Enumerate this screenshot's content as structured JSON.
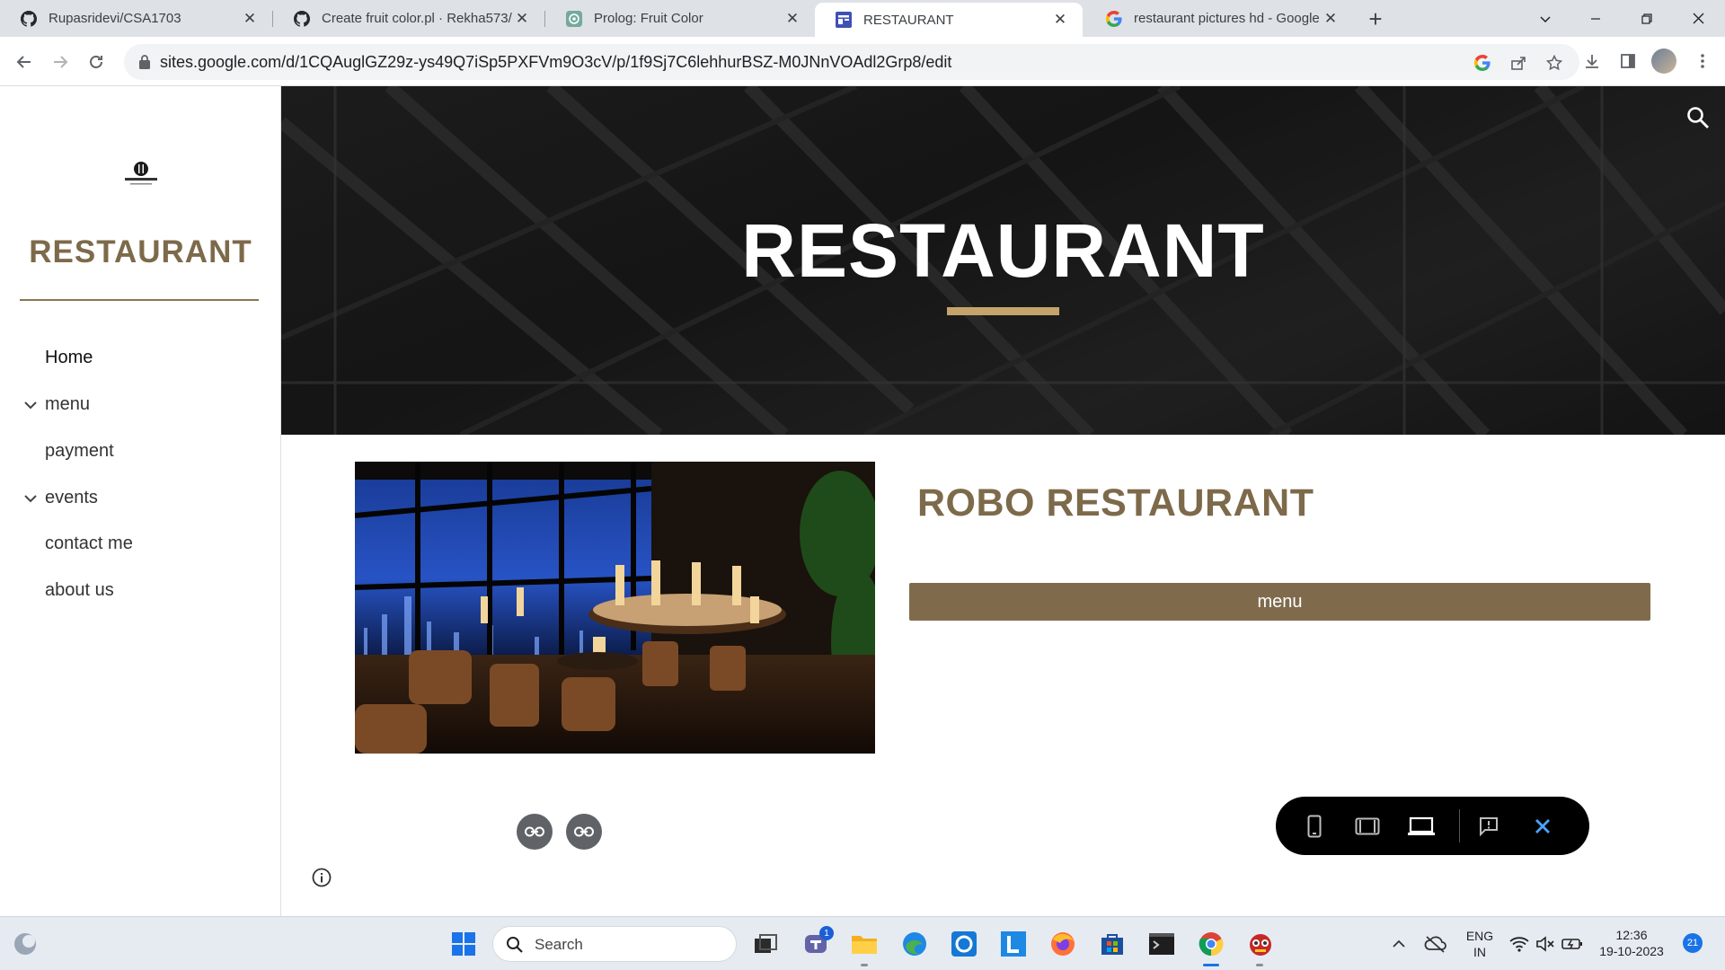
{
  "browser": {
    "tabs": [
      {
        "title": "Rupasridevi/CSA1703",
        "icon": "github-icon"
      },
      {
        "title": "Create fruit color.pl · Rekha573/(",
        "icon": "github-icon"
      },
      {
        "title": "Prolog: Fruit Color",
        "icon": "chatgpt-icon"
      },
      {
        "title": "RESTAURANT",
        "icon": "google-sites-icon",
        "active": true
      },
      {
        "title": "restaurant pictures hd - Google S",
        "icon": "google-icon"
      }
    ],
    "url": "sites.google.com/d/1CQAuglGZ29z-ys49Q7iSp5PXFVm9O3cV/p/1f9Sj7C6lehhurBSZ-M0JNnVOAdl2Grp8/edit"
  },
  "site": {
    "sidebar_title": "RESTAURANT",
    "nav": [
      {
        "label": "Home",
        "expandable": false
      },
      {
        "label": "menu",
        "expandable": true
      },
      {
        "label": "payment",
        "expandable": false
      },
      {
        "label": "events",
        "expandable": true
      },
      {
        "label": "contact me",
        "expandable": false
      },
      {
        "label": "about us",
        "expandable": false
      }
    ],
    "hero_title": "RESTAURANT",
    "heading": "ROBO RESTAURANT",
    "menu_button": "menu"
  },
  "taskbar": {
    "search_label": "Search",
    "teams_badge": "1",
    "language": "ENG",
    "region": "IN",
    "time": "12:36",
    "date": "19-10-2023",
    "notifications": "21"
  },
  "colors": {
    "accent_brown": "#7d6a4a",
    "button_brown": "#7f6b4c",
    "hero_rule_gold": "#c4a46a"
  }
}
